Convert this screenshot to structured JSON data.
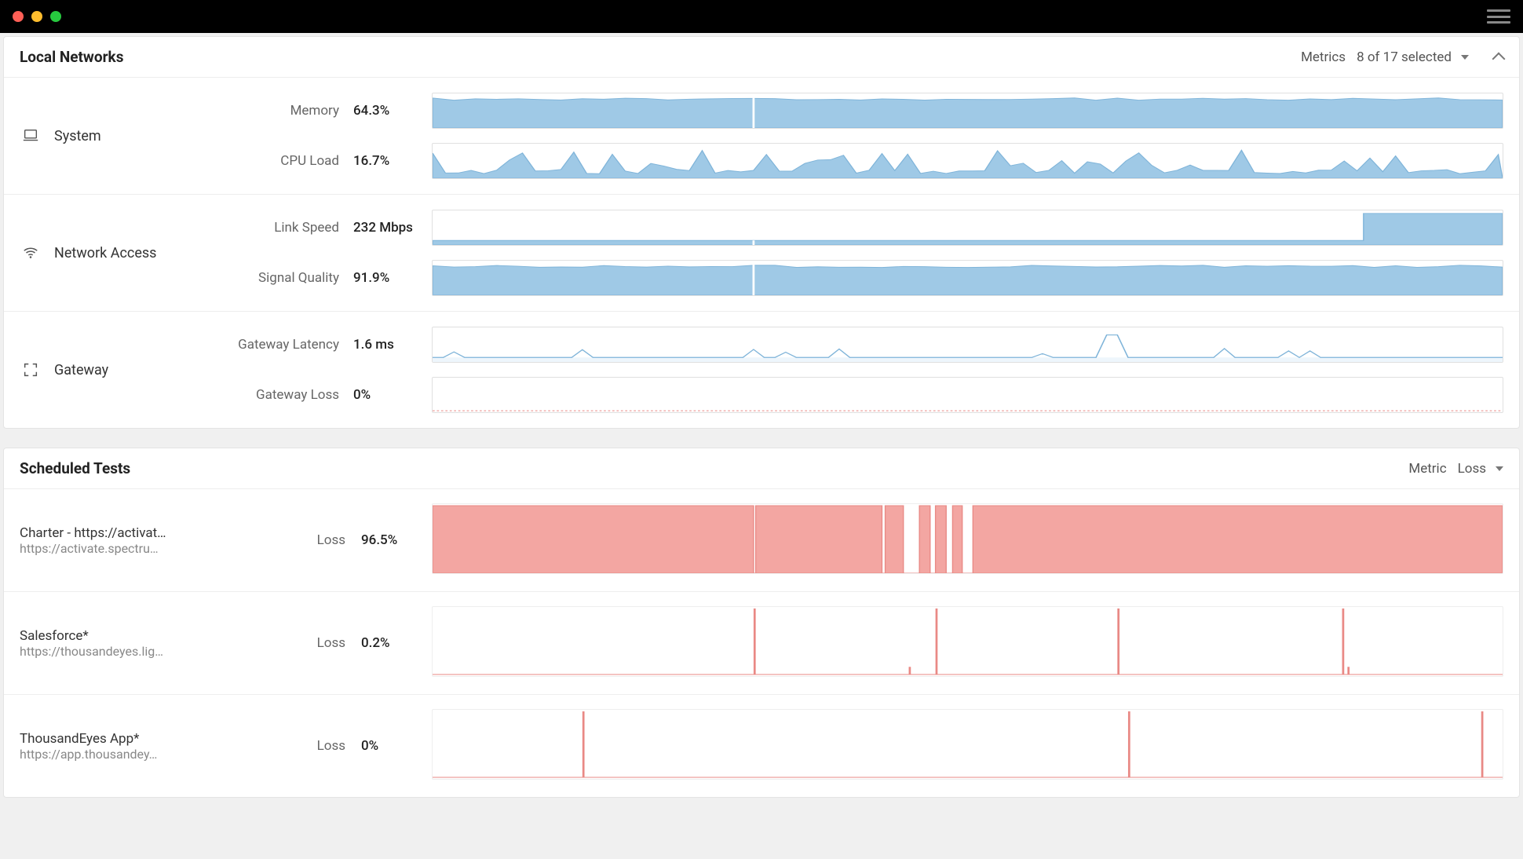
{
  "colors": {
    "blue": "#9fc9e6",
    "blueStroke": "#7fb4d9",
    "red": "#f3a6a2",
    "redStroke": "#e98985"
  },
  "localNetworks": {
    "title": "Local Networks",
    "metricsLabel": "Metrics",
    "metricsSummary": "8 of 17 selected",
    "groups": [
      {
        "icon": "laptop",
        "label": "System",
        "metrics": [
          {
            "name": "Memory",
            "value": "64.3%",
            "style": "filled"
          },
          {
            "name": "CPU Load",
            "value": "16.7%",
            "style": "spiky"
          }
        ]
      },
      {
        "icon": "wifi",
        "label": "Network Access",
        "metrics": [
          {
            "name": "Link Speed",
            "value": "232 Mbps",
            "style": "step"
          },
          {
            "name": "Signal Quality",
            "value": "91.9%",
            "style": "filled"
          }
        ]
      },
      {
        "icon": "gateway",
        "label": "Gateway",
        "metrics": [
          {
            "name": "Gateway Latency",
            "value": "1.6 ms",
            "style": "lowspike"
          },
          {
            "name": "Gateway Loss",
            "value": "0%",
            "style": "flat"
          }
        ]
      }
    ]
  },
  "scheduledTests": {
    "title": "Scheduled Tests",
    "metricLabel": "Metric",
    "metricValue": "Loss",
    "tests": [
      {
        "name": "Charter - https://activat…",
        "url": "https://activate.spectru…",
        "metric": "Loss",
        "value": "96.5%",
        "style": "full_dips"
      },
      {
        "name": "Salesforce*",
        "url": "https://thousandeyes.lig…",
        "metric": "Loss",
        "value": "0.2%",
        "style": "sparse_spikes"
      },
      {
        "name": "ThousandEyes App*",
        "url": "https://app.thousandey…",
        "metric": "Loss",
        "value": "0%",
        "style": "rare_spikes"
      }
    ]
  },
  "chart_data": [
    {
      "type": "area",
      "title": "Memory",
      "ylabel": "%",
      "ylim": [
        0,
        100
      ],
      "values_summary": "steady ~64%",
      "current": 64.3
    },
    {
      "type": "area",
      "title": "CPU Load",
      "ylabel": "%",
      "ylim": [
        0,
        100
      ],
      "values_summary": "spiky 5-40%",
      "current": 16.7
    },
    {
      "type": "area",
      "title": "Link Speed",
      "ylabel": "Mbps",
      "ylim": [
        0,
        300
      ],
      "values_summary": "low flat then step up",
      "current": 232
    },
    {
      "type": "area",
      "title": "Signal Quality",
      "ylabel": "%",
      "ylim": [
        0,
        100
      ],
      "values_summary": "steady ~92%",
      "current": 91.9
    },
    {
      "type": "line",
      "title": "Gateway Latency",
      "ylabel": "ms",
      "ylim": [
        0,
        20
      ],
      "values_summary": "baseline ~1.5ms small spikes, one large",
      "current": 1.6
    },
    {
      "type": "line",
      "title": "Gateway Loss",
      "ylabel": "%",
      "ylim": [
        0,
        100
      ],
      "values_summary": "flat 0%",
      "current": 0
    },
    {
      "type": "area",
      "title": "Charter Loss",
      "ylabel": "%",
      "ylim": [
        0,
        100
      ],
      "values_summary": "near 100% with brief dips",
      "current": 96.5
    },
    {
      "type": "bar",
      "title": "Salesforce Loss",
      "ylabel": "%",
      "ylim": [
        0,
        100
      ],
      "values_summary": "~4 tall spikes",
      "current": 0.2
    },
    {
      "type": "bar",
      "title": "ThousandEyes App Loss",
      "ylabel": "%",
      "ylim": [
        0,
        100
      ],
      "values_summary": "~3 tall spikes",
      "current": 0
    }
  ]
}
